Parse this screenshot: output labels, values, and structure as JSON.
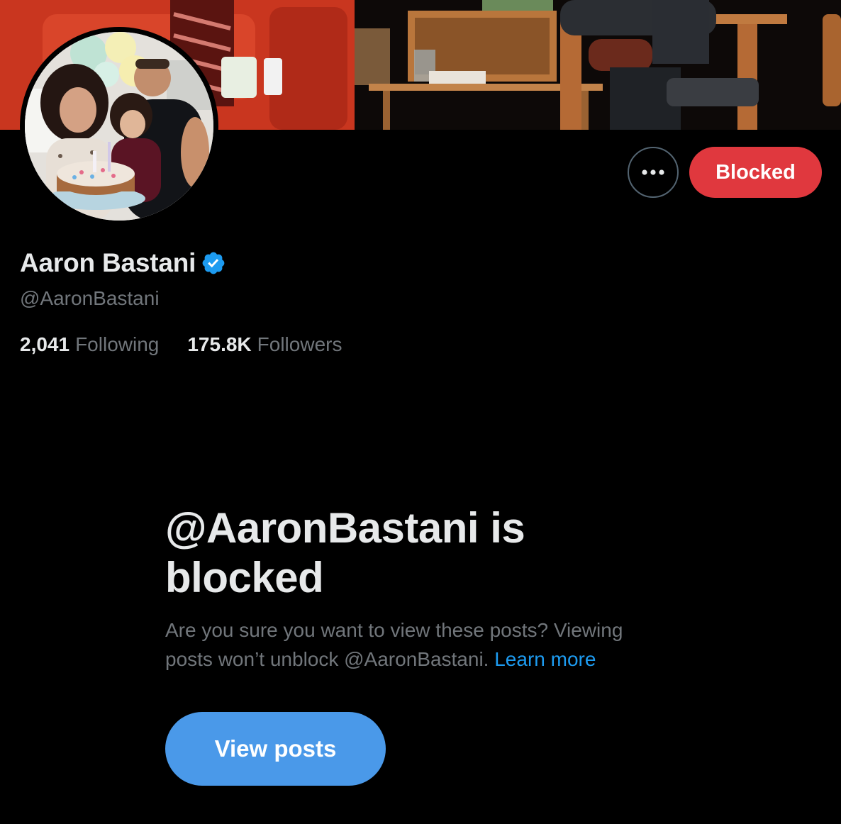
{
  "header": {
    "banner_alt": "Profile banner photo",
    "avatar_alt": "Profile photo"
  },
  "actions": {
    "more_icon": "more-horizontal-icon",
    "blocked_label": "Blocked"
  },
  "profile": {
    "display_name": "Aaron Bastani",
    "verified_icon": "verified-badge-icon",
    "handle": "@AaronBastani",
    "following_count": "2,041",
    "following_label": "Following",
    "followers_count": "175.8K",
    "followers_label": "Followers"
  },
  "blocked_notice": {
    "title": "@AaronBastani is blocked",
    "description": "Are you sure you want to view these posts? Viewing posts won’t unblock @AaronBastani.",
    "learn_more": "Learn more",
    "view_posts_label": "View posts"
  },
  "colors": {
    "background": "#000000",
    "blocked_button": "#e0383e",
    "view_posts_button": "#4a99e9",
    "link": "#1d9bf0",
    "secondary_text": "#71767b",
    "verified_badge": "#1d9bf0"
  }
}
